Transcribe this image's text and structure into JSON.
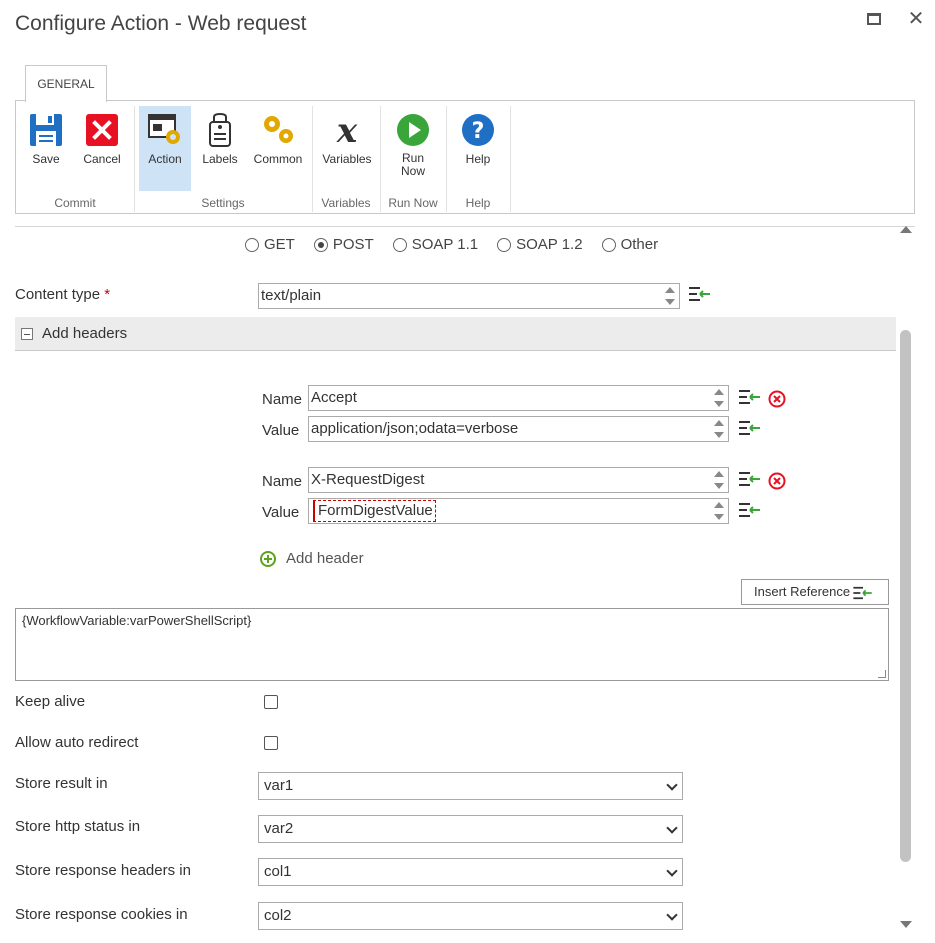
{
  "window": {
    "title": "Configure Action - Web request"
  },
  "ribbon": {
    "tab": "GENERAL",
    "buttons": {
      "save": "Save",
      "cancel": "Cancel",
      "action": "Action",
      "labels": "Labels",
      "common": "Common",
      "variables": "Variables",
      "run_now": "Run Now",
      "help": "Help"
    },
    "groups": {
      "commit": "Commit",
      "settings": "Settings",
      "variables": "Variables",
      "run_now": "Run Now",
      "help": "Help"
    }
  },
  "methods": {
    "options": [
      "GET",
      "POST",
      "SOAP 1.1",
      "SOAP 1.2",
      "Other"
    ],
    "selected": "POST"
  },
  "content_type": {
    "label": "Content type",
    "required_mark": "*",
    "value": "text/plain"
  },
  "headers_section": {
    "title": "Add headers",
    "name_label": "Name",
    "value_label": "Value",
    "headers": [
      {
        "name": "Accept",
        "value": "application/json;odata=verbose"
      },
      {
        "name": "X-RequestDigest",
        "value": "FormDigestValue"
      }
    ],
    "add_header": "Add header"
  },
  "body": {
    "insert_reference": "Insert Reference",
    "text": "{WorkflowVariable:varPowerShellScript}"
  },
  "options": {
    "keep_alive": {
      "label": "Keep alive",
      "checked": false
    },
    "allow_auto_redirect": {
      "label": "Allow auto redirect",
      "checked": false
    },
    "store_result": {
      "label": "Store result in",
      "value": "var1"
    },
    "store_http_status": {
      "label": "Store http status in",
      "value": "var2"
    },
    "store_response_headers": {
      "label": "Store response headers in",
      "value": "col1"
    },
    "store_response_cookies": {
      "label": "Store response cookies in",
      "value": "col2"
    }
  },
  "colors": {
    "accent_blue": "#1f6fc5",
    "cancel_red": "#e81123",
    "gear_gold": "#e0a800",
    "run_green": "#3aa53a",
    "add_green": "#5aa31b",
    "active_bg": "#cfe3f7"
  }
}
